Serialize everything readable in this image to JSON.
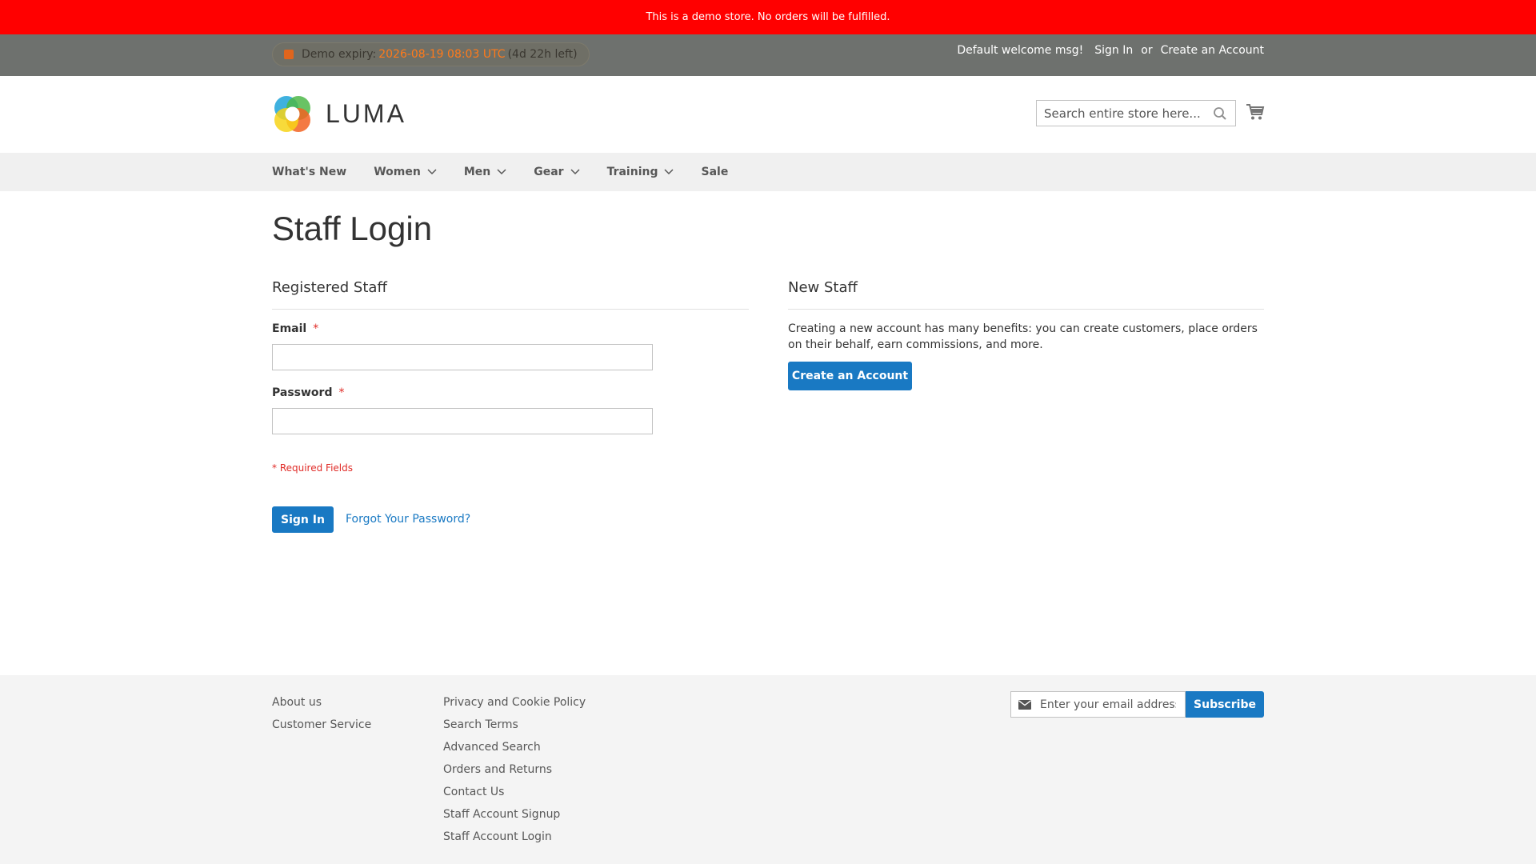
{
  "demo_notice": "This is a demo store. No orders will be fulfilled.",
  "demo_expiry": {
    "label": "Demo expiry:",
    "date": "2026-08-19 08:03 UTC",
    "left": "(4d 22h left)"
  },
  "header_links": {
    "welcome": "Default welcome msg!",
    "sign_in": "Sign In",
    "or": "or",
    "create_account": "Create an Account"
  },
  "logo": {
    "text": "LUMA"
  },
  "search": {
    "placeholder": "Search entire store here..."
  },
  "nav": {
    "items": [
      {
        "label": "What's New",
        "has_dropdown": false
      },
      {
        "label": "Women",
        "has_dropdown": true
      },
      {
        "label": "Men",
        "has_dropdown": true
      },
      {
        "label": "Gear",
        "has_dropdown": true
      },
      {
        "label": "Training",
        "has_dropdown": true
      },
      {
        "label": "Sale",
        "has_dropdown": false
      }
    ]
  },
  "page_title": "Staff Login",
  "registered": {
    "title": "Registered Staff",
    "email_label": "Email",
    "password_label": "Password",
    "required_star": "*",
    "required_note": "* Required Fields",
    "sign_in_button": "Sign In",
    "forgot_link": "Forgot Your Password?"
  },
  "new_staff": {
    "title": "New Staff",
    "text": "Creating a new account has many benefits: you can create customers, place orders on their behalf, earn commissions, and more.",
    "create_button": "Create an Account"
  },
  "footer": {
    "col1": [
      "About us",
      "Customer Service"
    ],
    "col2": [
      "Privacy and Cookie Policy",
      "Search Terms",
      "Advanced Search",
      "Orders and Returns",
      "Contact Us",
      "Staff Account Signup",
      "Staff Account Login"
    ],
    "newsletter_placeholder": "Enter your email address",
    "subscribe_button": "Subscribe"
  },
  "colors": {
    "notice_bg": "#ff0000",
    "panel_bg": "#6e716e",
    "primary": "#1979c3",
    "required": "#e02b27"
  }
}
